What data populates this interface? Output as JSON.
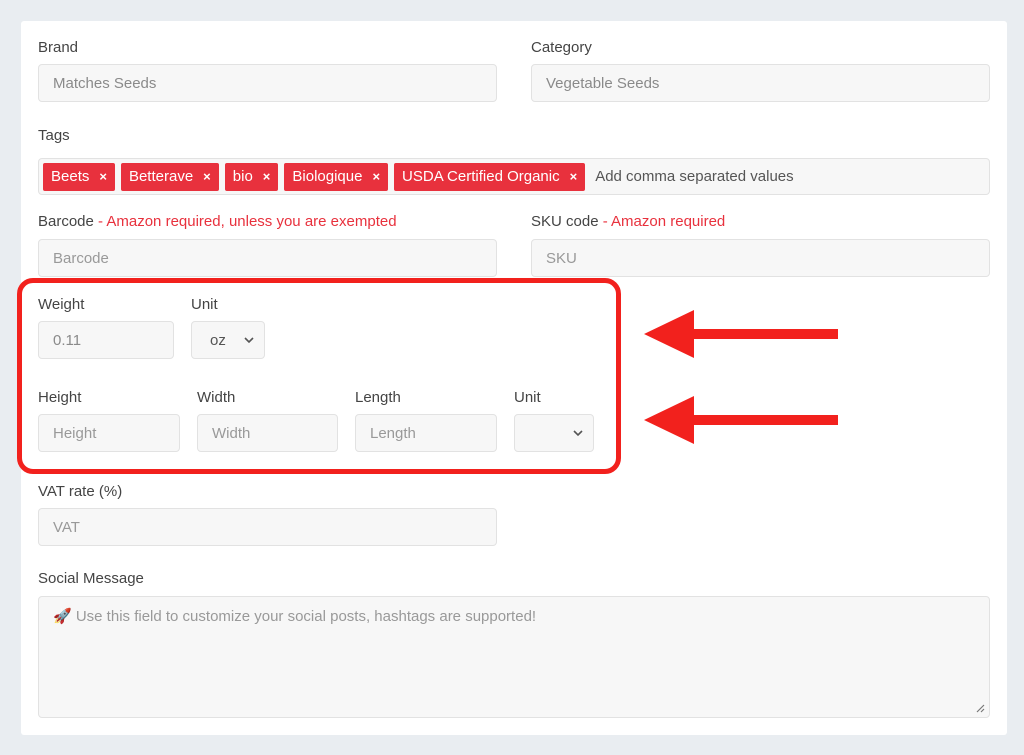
{
  "brand": {
    "label": "Brand",
    "value": "Matches Seeds"
  },
  "category": {
    "label": "Category",
    "value": "Vegetable Seeds"
  },
  "tags": {
    "label": "Tags",
    "items": [
      "Beets",
      "Betterave",
      "bio",
      "Biologique",
      "USDA Certified Organic"
    ],
    "remove_glyph": "×",
    "placeholder": "Add comma separated values"
  },
  "barcode": {
    "label": "Barcode",
    "note": " - Amazon required, unless you are exempted",
    "placeholder": "Barcode"
  },
  "sku": {
    "label": "SKU code",
    "note": " - Amazon required",
    "placeholder": "SKU"
  },
  "weight": {
    "label": "Weight",
    "value": "0.11"
  },
  "weight_unit": {
    "label": "Unit",
    "value": "oz"
  },
  "height": {
    "label": "Height",
    "placeholder": "Height"
  },
  "width": {
    "label": "Width",
    "placeholder": "Width"
  },
  "length": {
    "label": "Length",
    "placeholder": "Length"
  },
  "dim_unit": {
    "label": "Unit",
    "value": ""
  },
  "vat": {
    "label": "VAT rate (%)",
    "placeholder": "VAT"
  },
  "social": {
    "label": "Social Message",
    "placeholder": "🚀 Use this field to customize your social posts, hashtags are supported!"
  },
  "colors": {
    "accent": "#e8313d",
    "annotation": "#f2211d",
    "background": "#e9edf1"
  }
}
